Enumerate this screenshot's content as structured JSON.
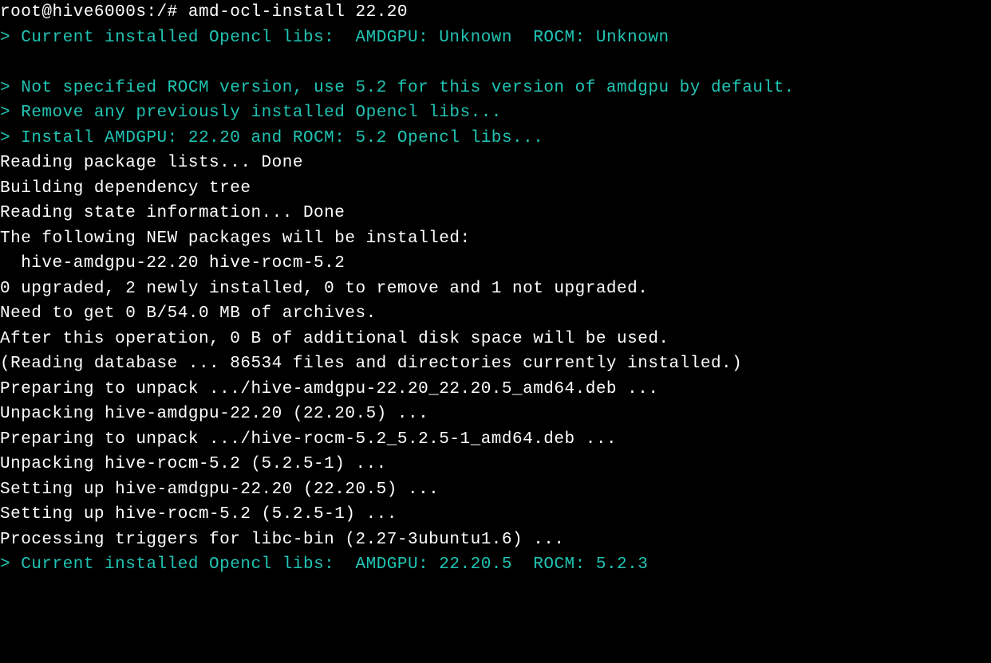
{
  "prompt": {
    "userhost": "root@hive6000s",
    "path": ":/#",
    "command": " amd-ocl-install 22.20"
  },
  "lines": {
    "l1_prefix": "> ",
    "l1_text": "Current installed Opencl libs:  ",
    "l1_amdgpu": "AMDGPU: Unknown  ",
    "l1_rocm": "ROCM: Unknown",
    "blank": "",
    "l2_prefix": "> ",
    "l2_text": "Not specified ROCM version, use 5.2 for this version of amdgpu by default.",
    "l3_prefix": "> ",
    "l3_text": "Remove any previously installed Opencl libs...",
    "l4_prefix": "> ",
    "l4_text": "Install AMDGPU: 22.20 and ROCM: 5.2 Opencl libs...",
    "l5": "Reading package lists... Done",
    "l6": "Building dependency tree",
    "l7": "Reading state information... Done",
    "l8": "The following NEW packages will be installed:",
    "l9": "  hive-amdgpu-22.20 hive-rocm-5.2",
    "l10": "0 upgraded, 2 newly installed, 0 to remove and 1 not upgraded.",
    "l11": "Need to get 0 B/54.0 MB of archives.",
    "l12": "After this operation, 0 B of additional disk space will be used.",
    "l13": "(Reading database ... 86534 files and directories currently installed.)",
    "l14": "Preparing to unpack .../hive-amdgpu-22.20_22.20.5_amd64.deb ...",
    "l15": "Unpacking hive-amdgpu-22.20 (22.20.5) ...",
    "l16": "Preparing to unpack .../hive-rocm-5.2_5.2.5-1_amd64.deb ...",
    "l17": "Unpacking hive-rocm-5.2 (5.2.5-1) ...",
    "l18": "Setting up hive-amdgpu-22.20 (22.20.5) ...",
    "l19": "Setting up hive-rocm-5.2 (5.2.5-1) ...",
    "l20": "Processing triggers for libc-bin (2.27-3ubuntu1.6) ...",
    "l21_prefix": "> ",
    "l21_text": "Current installed Opencl libs:  ",
    "l21_amdgpu": "AMDGPU: 22.20.5  ",
    "l21_rocm": "ROCM: 5.2.3"
  }
}
